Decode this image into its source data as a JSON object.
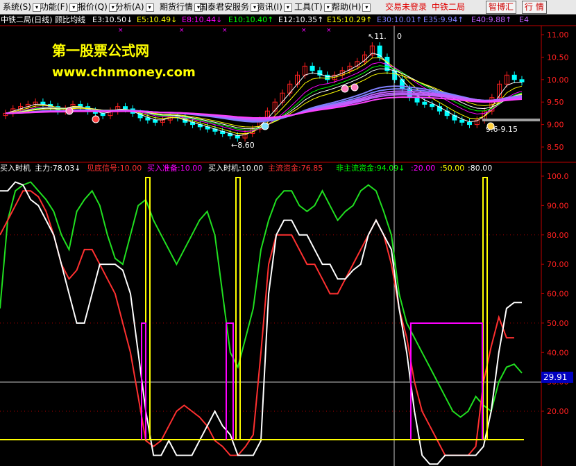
{
  "menu": {
    "items": [
      {
        "label": "系统(S)",
        "x": 4
      },
      {
        "label": "功能(F)",
        "x": 58
      },
      {
        "label": "报价(Q)",
        "x": 112
      },
      {
        "label": "分析(A)",
        "x": 166
      },
      {
        "label": "期货行情",
        "x": 230
      },
      {
        "label": "国泰君安服务",
        "x": 287
      },
      {
        "label": "资讯(I)",
        "x": 370
      },
      {
        "label": "工具(T)",
        "x": 424
      },
      {
        "label": "帮助(H)",
        "x": 478
      }
    ],
    "trade_status": "交易未登录",
    "stock_name": "中铁二局",
    "btn_zhihuihui": "智博汇",
    "btn_hangqing": "行 情"
  },
  "chart_header": {
    "title": "中铁二局(日线) 顾比均线",
    "mas": [
      {
        "label": "E3:10.50",
        "arrow": "↓",
        "color": "#ffffff"
      },
      {
        "label": "E5:10.49",
        "arrow": "↓",
        "color": "#ffff00"
      },
      {
        "label": "E8:10.44",
        "arrow": "↓",
        "color": "#ff00ff"
      },
      {
        "label": "E10:10.40",
        "arrow": "↑",
        "color": "#00ff00"
      },
      {
        "label": "E12:10.35",
        "arrow": "↑",
        "color": "#ffffff"
      },
      {
        "label": "E15:10.29",
        "arrow": "↑",
        "color": "#ffff00"
      },
      {
        "label": "E30:10.01",
        "arrow": "↑",
        "color": "#8080ff"
      },
      {
        "label": "E35:9.94",
        "arrow": "↑",
        "color": "#8080ff"
      },
      {
        "label": "E40:9.88",
        "arrow": "↑",
        "color": "#c060ff"
      },
      {
        "label": "E4",
        "arrow": "",
        "color": "#c060ff"
      }
    ]
  },
  "price_axis": [
    "11.00",
    "10.50",
    "10.00",
    "9.50",
    "9.00",
    "8.50"
  ],
  "annotations": {
    "high": "11.",
    "high2": "0",
    "low": "8.60",
    "right": "9.6-9.15"
  },
  "watermark": {
    "line1": "第一股票公式网",
    "line2": "www.chnmoney.com"
  },
  "indicator_header": {
    "items": [
      {
        "label": "买入时机",
        "color": "#ffffff"
      },
      {
        "label": "主力:78.03",
        "arrow": "↓",
        "color": "#ffffff"
      },
      {
        "label": "见底信号:10.00",
        "color": "#ff3030"
      },
      {
        "label": "买入准备:10.00",
        "color": "#ff00ff"
      },
      {
        "label": "买入时机:10.00",
        "color": "#ffffff"
      },
      {
        "label": "主流资金:76.85",
        "color": "#ff3030"
      },
      {
        "label": "非主流资金:94.09",
        "arrow": "↓",
        "color": "#00ff00"
      },
      {
        "label": ":20.00",
        "color": "#ff00ff"
      },
      {
        "label": ":50.00",
        "color": "#ffff00"
      },
      {
        "label": ":80.00",
        "color": "#ffffff"
      }
    ]
  },
  "indicator_axis": [
    "100.0",
    "90.00",
    "80.00",
    "70.00",
    "60.00",
    "50.00",
    "40.00",
    "30.00",
    "20.00"
  ],
  "crosshair_value": "29.91",
  "colors": {
    "up": "#ff2020",
    "down": "#00ffff",
    "axis": "#ff2020",
    "white_line": "#ffffff",
    "red_line": "#ff2020",
    "green_line": "#20e020",
    "magenta": "#ff00ff",
    "yellow": "#ffff00"
  },
  "chart_data": {
    "type": "line",
    "panel": "indicator",
    "ylim": [
      0,
      100
    ],
    "series": [
      {
        "name": "主力",
        "color": "#ffffff",
        "values": [
          95,
          95,
          98,
          97,
          92,
          90,
          85,
          80,
          70,
          60,
          50,
          50,
          60,
          70,
          70,
          70,
          68,
          60,
          40,
          20,
          5,
          5,
          10,
          5,
          5,
          5,
          10,
          15,
          20,
          15,
          12,
          5,
          5,
          5,
          10,
          60,
          80,
          85,
          85,
          80,
          80,
          75,
          70,
          70,
          65,
          65,
          68,
          70,
          80,
          85,
          80,
          75,
          55,
          40,
          20,
          5,
          2,
          2,
          5,
          5,
          5,
          5,
          5,
          8,
          20,
          40,
          55,
          57,
          57
        ]
      },
      {
        "name": "见底信号/主流资金",
        "color": "#ff3030",
        "values": [
          80,
          85,
          90,
          95,
          95,
          93,
          88,
          80,
          70,
          65,
          68,
          75,
          75,
          70,
          65,
          60,
          50,
          40,
          25,
          10,
          8,
          10,
          15,
          20,
          22,
          20,
          18,
          15,
          10,
          8,
          5,
          5,
          8,
          12,
          40,
          70,
          80,
          80,
          80,
          75,
          70,
          70,
          65,
          60,
          60,
          65,
          70,
          75,
          80,
          85,
          80,
          70,
          55,
          45,
          30,
          20,
          15,
          10,
          5,
          5,
          5,
          5,
          8,
          30,
          42,
          52,
          45,
          45
        ]
      },
      {
        "name": "非主流资金",
        "color": "#20e020",
        "values": [
          55,
          85,
          95,
          97,
          98,
          95,
          92,
          88,
          80,
          75,
          88,
          92,
          95,
          90,
          80,
          72,
          70,
          80,
          90,
          92,
          85,
          80,
          75,
          70,
          75,
          80,
          85,
          88,
          80,
          60,
          40,
          35,
          45,
          55,
          75,
          85,
          92,
          95,
          95,
          90,
          88,
          90,
          95,
          90,
          85,
          88,
          90,
          95,
          97,
          95,
          88,
          80,
          60,
          50,
          45,
          40,
          35,
          30,
          25,
          20,
          18,
          20,
          25,
          22,
          20,
          30,
          35,
          36,
          33
        ]
      }
    ]
  }
}
